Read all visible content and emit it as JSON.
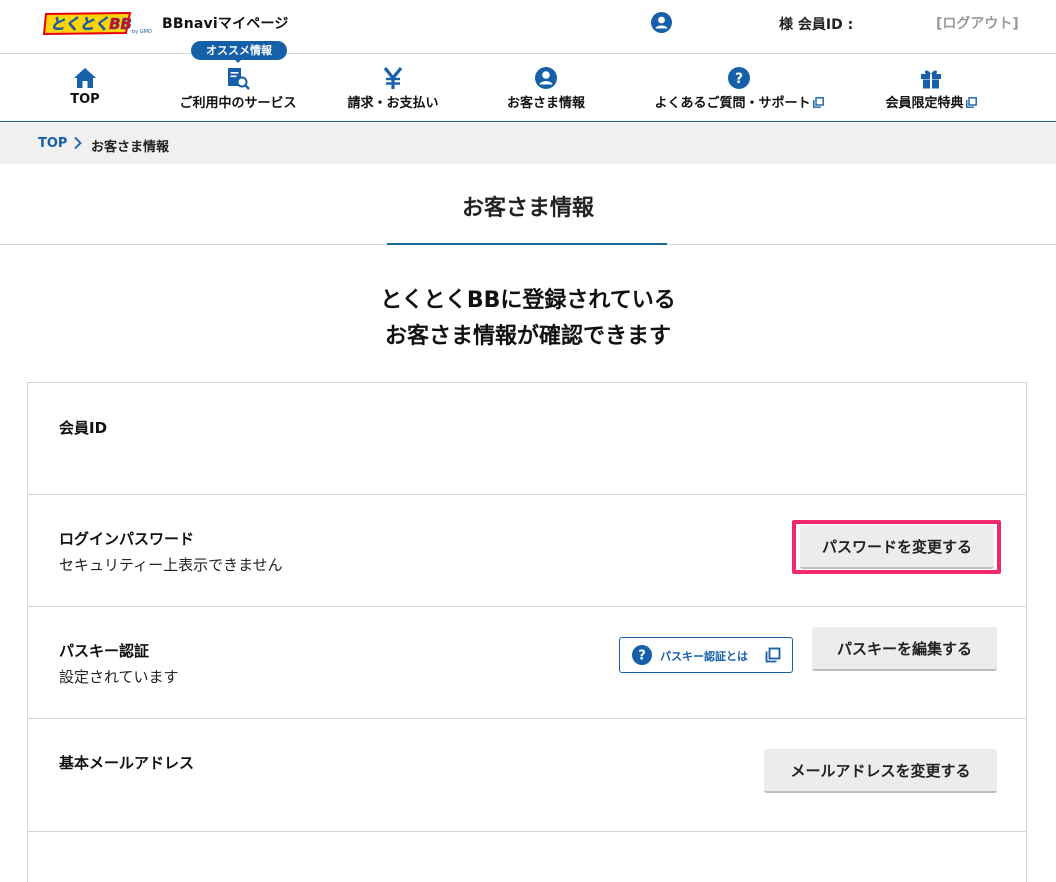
{
  "header": {
    "logo_text": "とくとくBB",
    "logo_sub": "by GMO",
    "app_title": "BBnaviマイページ",
    "member_label": "様  会員ID :",
    "logout": "[ログアウト]"
  },
  "nav": {
    "badge": "オススメ情報",
    "items": [
      {
        "label": "TOP",
        "icon": "home-icon"
      },
      {
        "label": "ご利用中のサービス",
        "icon": "service-search-icon"
      },
      {
        "label": "請求・お支払い",
        "icon": "yen-icon"
      },
      {
        "label": "お客さま情報",
        "icon": "user-icon"
      },
      {
        "label": "よくあるご質問・サポート",
        "icon": "question-icon"
      },
      {
        "label": "会員限定特典",
        "icon": "gift-icon"
      }
    ]
  },
  "breadcrumb": {
    "top": "TOP",
    "current": "お客さま情報"
  },
  "page": {
    "title": "お客さま情報",
    "lead_line1": "とくとくBBに登録されている",
    "lead_line2": "お客さま情報が確認できます"
  },
  "rows": {
    "member_id": {
      "label": "会員ID"
    },
    "password": {
      "label": "ログインパスワード",
      "value": "セキュリティー上表示できません",
      "button": "パスワードを変更する"
    },
    "passkey": {
      "label": "パスキー認証",
      "value": "設定されています",
      "help": "パスキー認証とは",
      "button": "パスキーを編集する"
    },
    "email": {
      "label": "基本メールアドレス",
      "button": "メールアドレスを変更する"
    }
  },
  "colors": {
    "brand_blue": "#1560a8",
    "highlight": "#f0286e",
    "logo_yellow": "#ffd400"
  }
}
